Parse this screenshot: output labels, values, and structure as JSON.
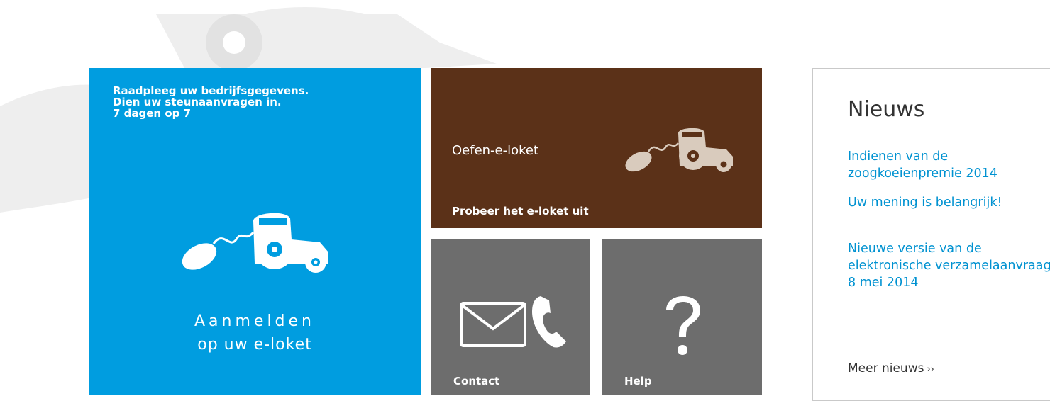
{
  "login_tile": {
    "intro_lines": [
      "Raadpleeg uw bedrijfsgegevens.",
      "Dien uw steunaanvragen in.",
      "7 dagen op 7"
    ],
    "label_line1": "Aanmelden",
    "label_line2": "op uw e-loket",
    "icon": "mouse-tractor-icon"
  },
  "practice_tile": {
    "title": "Oefen-e-loket",
    "subtitle": "Probeer het e-loket uit",
    "icon": "mouse-tractor-icon"
  },
  "contact_tile": {
    "label": "Contact",
    "icons": [
      "envelope-icon",
      "phone-icon"
    ]
  },
  "help_tile": {
    "label": "Help",
    "icon": "question-mark-icon"
  },
  "news": {
    "title": "Nieuws",
    "items": [
      {
        "lines": [
          "Indienen van de",
          "zoogkoeienpremie 2014"
        ]
      },
      {
        "lines": [
          "Uw mening is belangrijk!"
        ]
      },
      {
        "lines": [
          "Nieuwe versie van de",
          "elektronische verzamelaanvraag",
          "8 mei 2014"
        ]
      }
    ],
    "more_label": "Meer nieuws",
    "more_chevron": "››"
  },
  "colors": {
    "login_blue": "#009de0",
    "practice_brown": "#5b3118",
    "grey_tile": "#6d6d6d",
    "news_link": "#0092d1"
  }
}
